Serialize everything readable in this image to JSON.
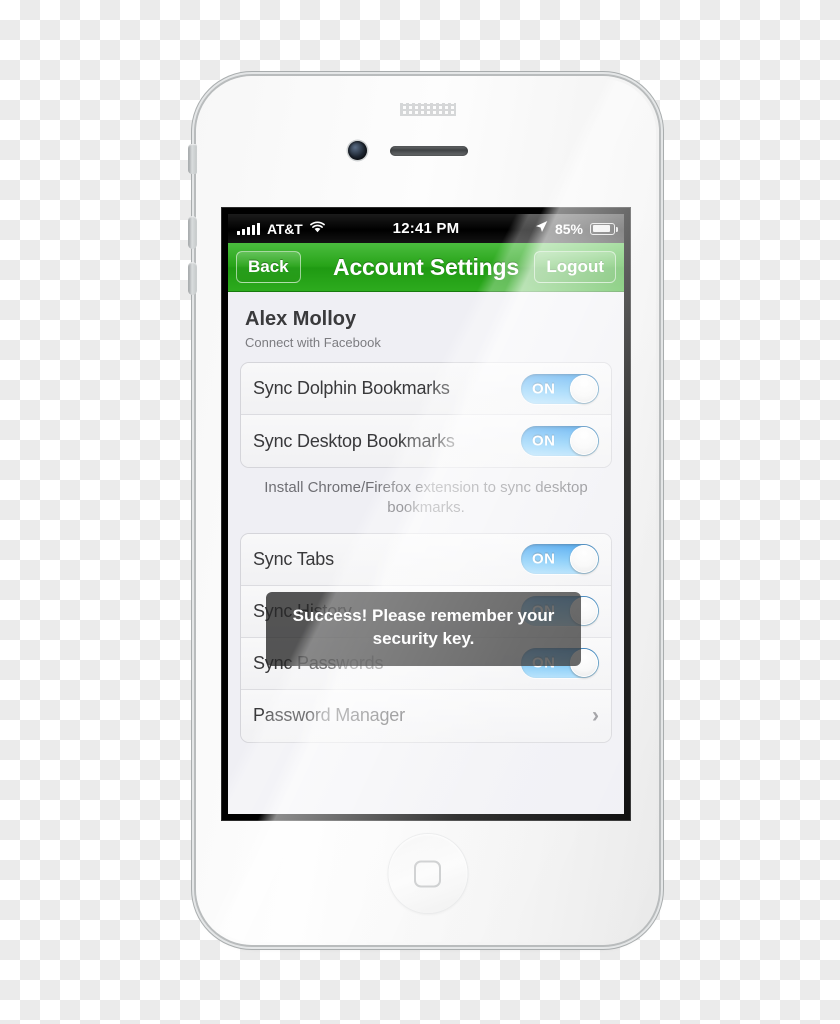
{
  "status_bar": {
    "signal_icon": "signal-bars-icon",
    "signal_strength": 5,
    "carrier": "AT&T",
    "wifi_icon": "wifi-icon",
    "time": "12:41 PM",
    "location_icon": "location-arrow-icon",
    "battery_percent": "85%",
    "battery_icon": "battery-icon"
  },
  "nav_bar": {
    "back_label": "Back",
    "title": "Account Settings",
    "logout_label": "Logout"
  },
  "profile": {
    "name": "Alex Molloy",
    "connect_label": "Connect with Facebook"
  },
  "settings_groups": [
    {
      "rows": [
        {
          "label": "Sync Dolphin Bookmarks",
          "control": "toggle",
          "value": "ON"
        },
        {
          "label": "Sync Desktop Bookmarks",
          "control": "toggle",
          "value": "ON"
        }
      ]
    },
    {
      "rows": [
        {
          "label": "Sync Tabs",
          "control": "toggle",
          "value": "ON"
        },
        {
          "label": "Sync History",
          "control": "toggle",
          "value": "ON"
        },
        {
          "label": "Sync Passwords",
          "control": "toggle",
          "value": "ON"
        },
        {
          "label": "Password Manager",
          "control": "chevron",
          "value": "›"
        }
      ]
    }
  ],
  "helper_text": "Install Chrome/Firefox extension to sync desktop bookmarks.",
  "toast": {
    "message": "Success! Please remember your security key."
  },
  "hardware": {
    "camera": "front-camera",
    "earpiece": "earpiece-speaker",
    "home_button": "home-button"
  },
  "colors": {
    "nav_green": "#27a318",
    "toggle_blue": "#2e9df0",
    "screen_bg": "#efeff4",
    "toast_bg": "rgba(38,38,38,0.78)"
  }
}
